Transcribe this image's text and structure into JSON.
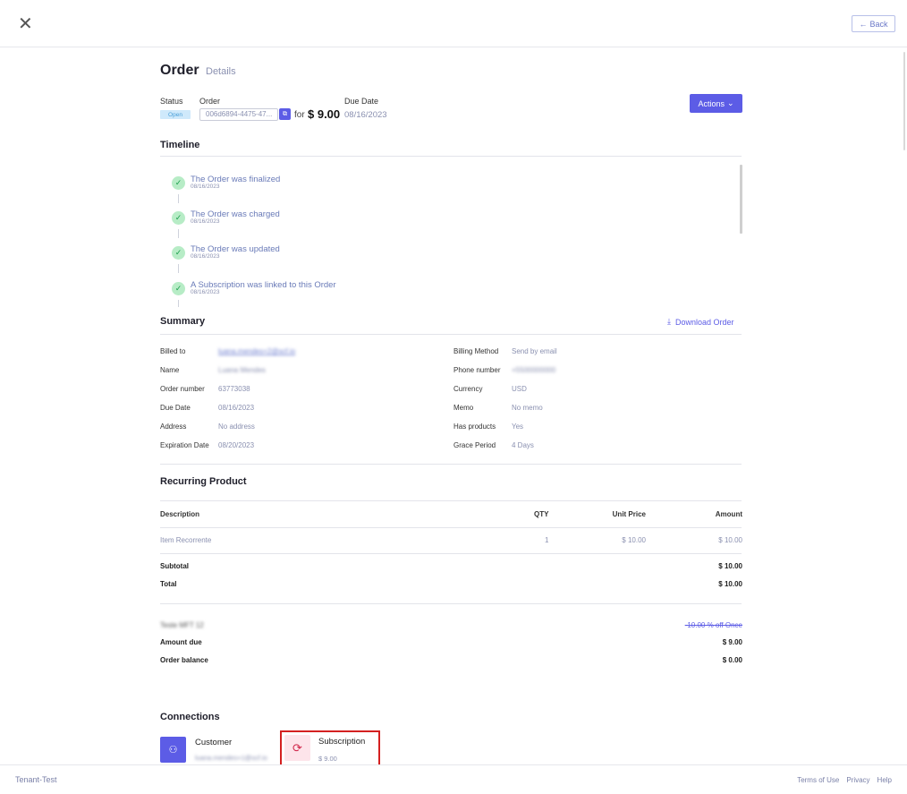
{
  "header": {
    "close_icon": "close-icon",
    "back_label": "Back"
  },
  "page": {
    "title": "Order",
    "subtitle": "Details"
  },
  "order_info": {
    "status_label": "Status",
    "status_value": "Open",
    "order_label": "Order",
    "order_id": "006d6894-4475-47...",
    "for_label": "for",
    "price": "$ 9.00",
    "due_date_label": "Due Date",
    "due_date_value": "08/16/2023",
    "actions_label": "Actions"
  },
  "timeline": {
    "title": "Timeline",
    "items": [
      {
        "text": "The Order was finalized",
        "date": "08/16/2023"
      },
      {
        "text": "The Order was charged",
        "date": "08/16/2023"
      },
      {
        "text": "The Order was updated",
        "date": "08/16/2023"
      },
      {
        "text": "A Subscription was linked to this Order",
        "date": "08/16/2023"
      }
    ]
  },
  "summary": {
    "title": "Summary",
    "download_label": "Download Order",
    "left": [
      {
        "label": "Billed to",
        "value": "luana.mendes+2@scf.io",
        "blurred": true
      },
      {
        "label": "Name",
        "value": "Luana Mendes",
        "blurred": true
      },
      {
        "label": "Order number",
        "value": "63773038"
      },
      {
        "label": "Due Date",
        "value": "08/16/2023"
      },
      {
        "label": "Address",
        "value": "No address"
      },
      {
        "label": "Expiration Date",
        "value": "08/20/2023"
      }
    ],
    "right": [
      {
        "label": "Billing Method",
        "value": "Send by email"
      },
      {
        "label": "Phone number",
        "value": "+5500000000",
        "blurred": true
      },
      {
        "label": "Currency",
        "value": "USD"
      },
      {
        "label": "Memo",
        "value": "No memo"
      },
      {
        "label": "Has products",
        "value": "Yes"
      },
      {
        "label": "Grace Period",
        "value": "4 Days"
      }
    ]
  },
  "recurring": {
    "title": "Recurring Product",
    "headers": {
      "description": "Description",
      "qty": "QTY",
      "unit_price": "Unit Price",
      "amount": "Amount"
    },
    "rows": [
      {
        "description": "Item Recorrente",
        "qty": "1",
        "unit_price": "$ 10.00",
        "amount": "$ 10.00"
      }
    ],
    "subtotal_label": "Subtotal",
    "subtotal_value": "$ 10.00",
    "total_label": "Total",
    "total_value": "$ 10.00",
    "discount_name": "Teste MFT 12",
    "discount_value": "-10.00 % off Once",
    "amount_due_label": "Amount due",
    "amount_due_value": "$ 9.00",
    "balance_label": "Order balance",
    "balance_value": "$ 0.00"
  },
  "connections": {
    "title": "Connections",
    "customer_label": "Customer",
    "customer_value": "luana.mendes+1@scf.io",
    "subscription_label": "Subscription",
    "subscription_value": "$ 9.00"
  },
  "footer": {
    "tenant": "Tenant-Test",
    "links": [
      "Terms of Use",
      "Privacy",
      "Help"
    ]
  },
  "colors": {
    "accent": "#5c5ce6",
    "highlight": "#d42020",
    "success": "#b7ecc6"
  }
}
